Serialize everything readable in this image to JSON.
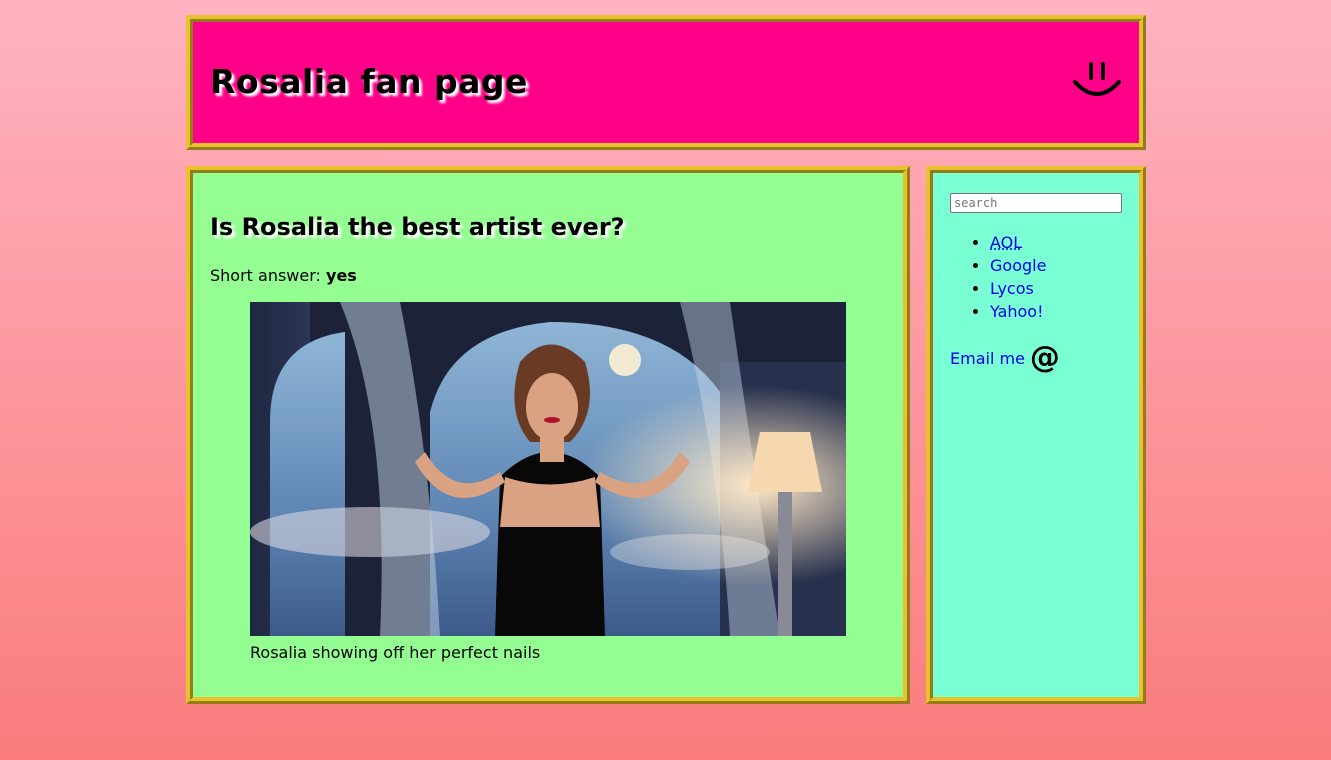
{
  "header": {
    "title": "Rosalia fan page",
    "icon": "smiley-face-icon"
  },
  "article": {
    "title": "Is Rosalia the best artist ever?",
    "short_answer_label": "Short answer:",
    "short_answer_value": "yes",
    "figure": {
      "image_description": "photo",
      "caption": "Rosalia showing off her perfect nails"
    }
  },
  "sidebar": {
    "search_placeholder": "search",
    "links": [
      {
        "label": "AOL"
      },
      {
        "label": "Google"
      },
      {
        "label": "Lycos"
      },
      {
        "label": "Yahoo!"
      }
    ],
    "email_label": "Email me",
    "email_icon": "at-sign-icon"
  },
  "colors": {
    "header_bg": "#ff0088",
    "main_bg": "#94fe92",
    "sidebar_bg": "#7affd4",
    "border": "#e8c22a",
    "link": "#0000ee"
  }
}
